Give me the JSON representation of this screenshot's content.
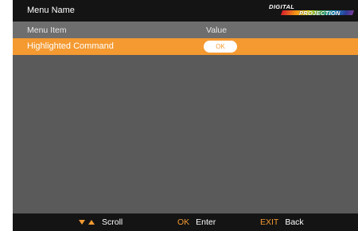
{
  "title_bar": {
    "menu_name": "Menu Name",
    "logo_line1": "DIGITAL",
    "logo_line2": "PROJECTION"
  },
  "columns": {
    "item": "Menu Item",
    "value": "Value"
  },
  "rows": [
    {
      "label": "Highlighted Command",
      "value": "OK",
      "highlighted": true
    }
  ],
  "footer": {
    "scroll": {
      "label": "Scroll"
    },
    "enter": {
      "key": "OK",
      "label": "Enter"
    },
    "back": {
      "key": "EXIT",
      "label": "Back"
    }
  },
  "colors": {
    "accent": "#f49a31",
    "title_bar_bg": "#141414",
    "body_bg": "#5a5a5a",
    "header_bg": "#6e6e6e"
  }
}
